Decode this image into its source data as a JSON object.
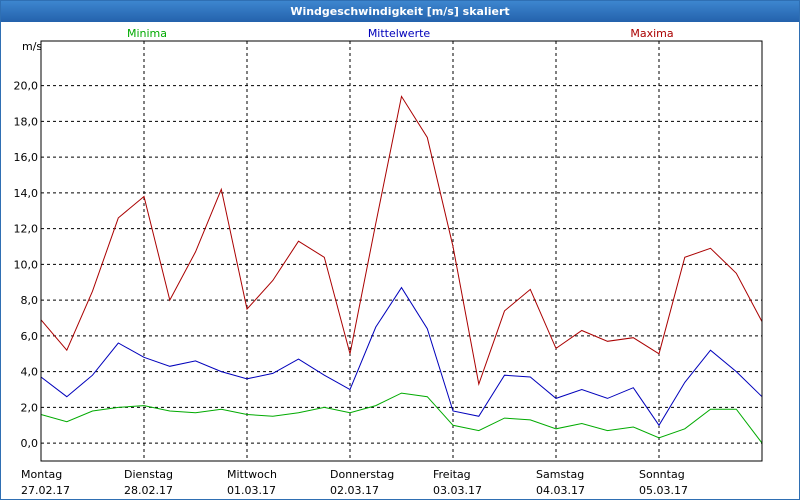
{
  "window": {
    "title": "Windgeschwindigkeit [m/s] skaliert"
  },
  "chart_data": {
    "type": "line",
    "title": "Windgeschwindigkeit [m/s] skaliert",
    "ylabel": "m/s",
    "ylim": [
      -1.0,
      22.5
    ],
    "yticks": [
      "0,0",
      "2,0",
      "4,0",
      "6,0",
      "8,0",
      "10,0",
      "12,0",
      "14,0",
      "16,0",
      "18,0",
      "20,0"
    ],
    "ytick_values": [
      0,
      2,
      4,
      6,
      8,
      10,
      12,
      14,
      16,
      18,
      20
    ],
    "grid": true,
    "legend": "top",
    "days": [
      {
        "weekday": "Montag",
        "date": "27.02.17"
      },
      {
        "weekday": "Dienstag",
        "date": "28.02.17"
      },
      {
        "weekday": "Mittwoch",
        "date": "01.03.17"
      },
      {
        "weekday": "Donnerstag",
        "date": "02.03.17"
      },
      {
        "weekday": "Freitag",
        "date": "03.03.17"
      },
      {
        "weekday": "Samstag",
        "date": "04.03.17"
      },
      {
        "weekday": "Sonntag",
        "date": "05.03.17"
      }
    ],
    "x_days": [
      0.0,
      0.25,
      0.5,
      0.75,
      1.0,
      1.25,
      1.5,
      1.75,
      2.0,
      2.25,
      2.5,
      2.75,
      3.0,
      3.25,
      3.5,
      3.75,
      4.0,
      4.25,
      4.5,
      4.75,
      5.0,
      5.25,
      5.5,
      5.75,
      6.0,
      6.25,
      6.5,
      6.75,
      7.0
    ],
    "series": [
      {
        "name": "Minima",
        "color": "#00aa00",
        "values": [
          1.6,
          1.2,
          1.8,
          2.0,
          2.1,
          1.8,
          1.7,
          1.9,
          1.6,
          1.5,
          1.7,
          2.0,
          1.7,
          2.1,
          2.8,
          2.6,
          1.0,
          0.7,
          1.4,
          1.3,
          0.8,
          1.1,
          0.7,
          0.9,
          0.3,
          0.8,
          1.9,
          1.9,
          0.0
        ]
      },
      {
        "name": "Mittelwerte",
        "color": "#0000bb",
        "values": [
          3.7,
          2.6,
          3.8,
          5.6,
          4.8,
          4.3,
          4.6,
          4.0,
          3.6,
          3.9,
          4.7,
          3.8,
          3.0,
          6.5,
          8.7,
          6.4,
          1.8,
          1.5,
          3.8,
          3.7,
          2.5,
          3.0,
          2.5,
          3.1,
          1.0,
          3.4,
          5.2,
          4.0,
          2.6
        ]
      },
      {
        "name": "Maxima",
        "color": "#aa0000",
        "values": [
          6.9,
          5.2,
          8.5,
          12.6,
          13.8,
          8.0,
          10.7,
          14.2,
          7.5,
          9.1,
          11.3,
          10.4,
          5.0,
          12.3,
          19.4,
          17.1,
          11.0,
          3.3,
          7.4,
          8.6,
          5.3,
          6.3,
          5.7,
          5.9,
          5.0,
          10.4,
          10.9,
          9.5,
          6.8
        ]
      }
    ]
  }
}
